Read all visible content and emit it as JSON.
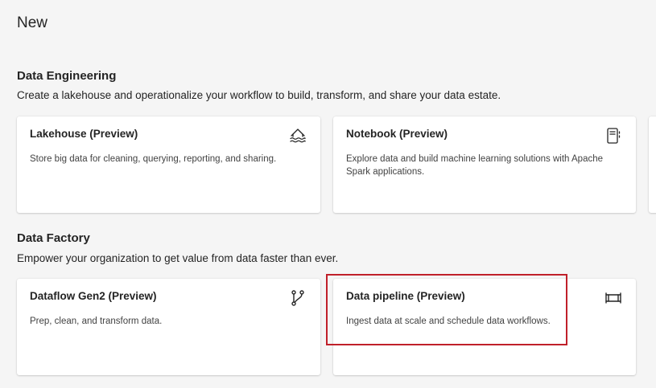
{
  "page": {
    "title": "New"
  },
  "sections": [
    {
      "title": "Data Engineering",
      "description": "Create a lakehouse and operationalize your workflow to build, transform, and share your data estate.",
      "cards": [
        {
          "title": "Lakehouse (Preview)",
          "description": "Store big data for cleaning, querying, reporting, and sharing.",
          "icon": "lakehouse-icon"
        },
        {
          "title": "Notebook (Preview)",
          "description": "Explore data and build machine learning solutions with Apache Spark applications.",
          "icon": "notebook-icon"
        }
      ]
    },
    {
      "title": "Data Factory",
      "description": "Empower your organization to get value from data faster than ever.",
      "cards": [
        {
          "title": "Dataflow Gen2 (Preview)",
          "description": "Prep, clean, and transform data.",
          "icon": "dataflow-icon"
        },
        {
          "title": "Data pipeline (Preview)",
          "description": "Ingest data at scale and schedule data workflows.",
          "icon": "pipeline-icon"
        }
      ]
    }
  ],
  "highlight": {
    "color": "#c0202a"
  }
}
